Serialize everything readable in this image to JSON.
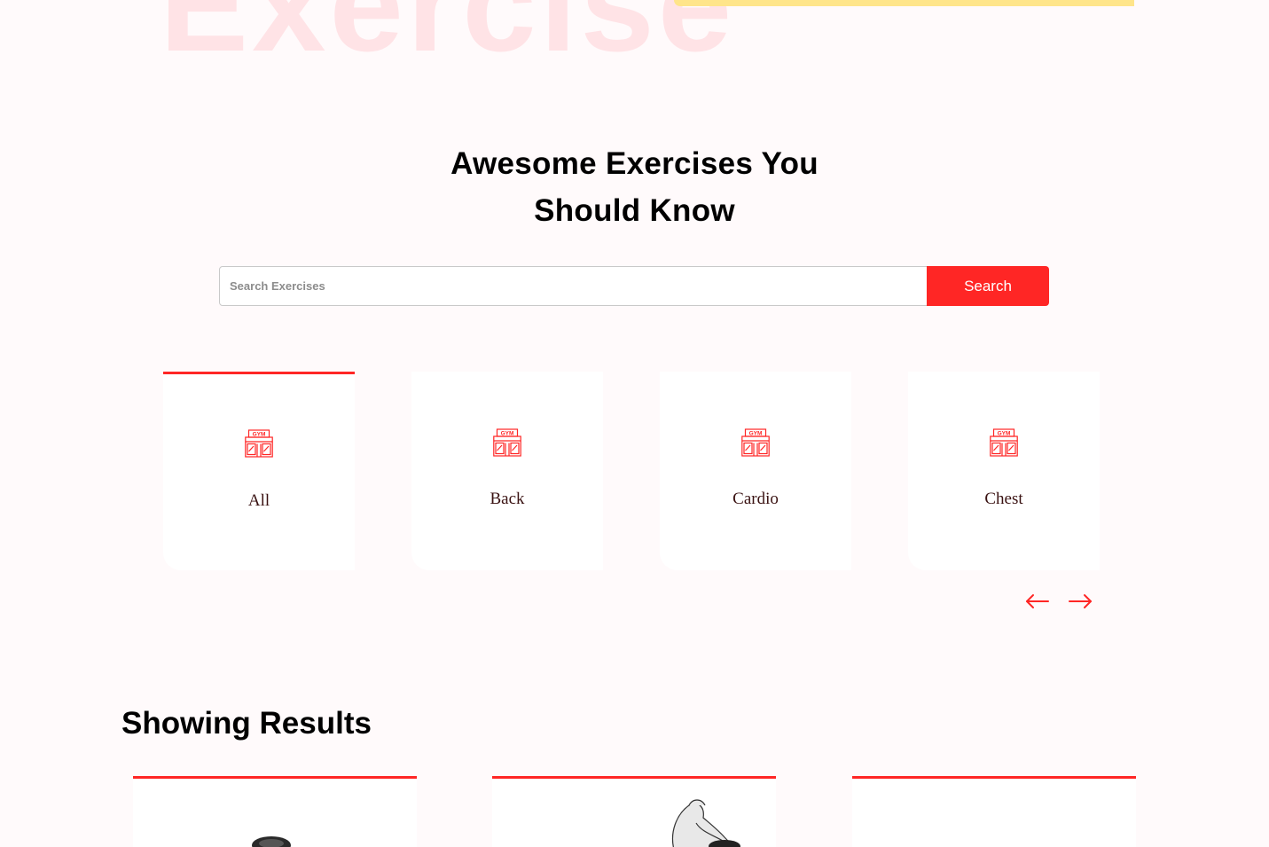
{
  "hero": {
    "background_text": "Exercise"
  },
  "exercises_section": {
    "title_line1": "Awesome Exercises You",
    "title_line2": "Should Know"
  },
  "search": {
    "placeholder": "Search Exercises",
    "button_label": "Search"
  },
  "categories": [
    {
      "label": "All",
      "icon": "gym-icon",
      "active": true
    },
    {
      "label": "Back",
      "icon": "gym-icon",
      "active": false
    },
    {
      "label": "Cardio",
      "icon": "gym-icon",
      "active": false
    },
    {
      "label": "Chest",
      "icon": "gym-icon",
      "active": false
    }
  ],
  "carousel": {
    "prev_icon": "left-arrow-icon",
    "next_icon": "right-arrow-icon"
  },
  "results": {
    "title": "Showing Results"
  },
  "colors": {
    "accent": "#ff2625",
    "hero_text": "#ffe3e6",
    "highlight": "#ffe58a",
    "background": "#fffafb"
  }
}
